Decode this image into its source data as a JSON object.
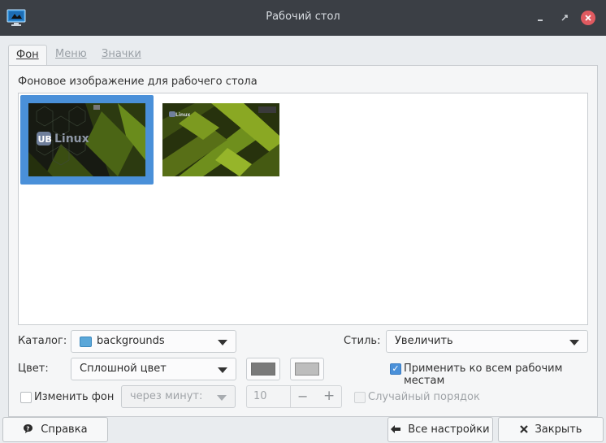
{
  "window": {
    "title": "Рабочий стол",
    "app_icon": "desktop-settings-icon"
  },
  "tabs": [
    {
      "label": "Фон",
      "active": true
    },
    {
      "label": "Меню",
      "active": false
    },
    {
      "label": "Значки",
      "active": false
    }
  ],
  "background": {
    "section_label": "Фоновое изображение для рабочего стола",
    "thumbnails": [
      {
        "name": "UBLinux wallpaper hexagons",
        "logo_text": "Linux",
        "selected": true
      },
      {
        "name": "UBLinux wallpaper diagonal",
        "logo_text": "Linux",
        "selected": false
      }
    ]
  },
  "folder": {
    "label": "Каталог:",
    "value": "backgrounds"
  },
  "style": {
    "label": "Стиль:",
    "value": "Увеличить"
  },
  "color": {
    "label": "Цвет:",
    "value": "Сплошной цвет",
    "swatch1": "#7a7a7a",
    "swatch2": "#bdbdbd"
  },
  "apply_all": {
    "label": "Применить ко всем рабочим местам",
    "checked": true
  },
  "change_bg": {
    "label": "Изменить фон",
    "checked": false,
    "interval_value": "через минут:",
    "number": "10",
    "minus": "−",
    "plus": "+"
  },
  "random_order": {
    "label": "Случайный порядок",
    "checked": false
  },
  "buttons": {
    "help": "Справка",
    "all_settings": "Все настройки",
    "close": "Закрыть"
  },
  "colors": {
    "accent": "#4a90d9",
    "titlebar": "#3b3f45",
    "close": "#e05a60"
  }
}
